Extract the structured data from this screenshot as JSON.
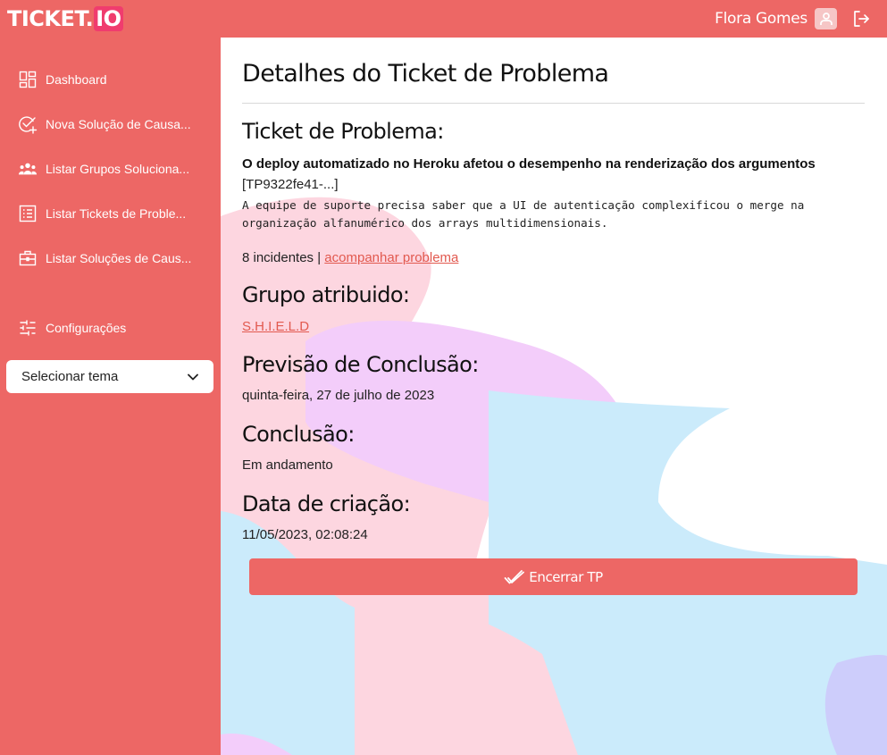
{
  "app": {
    "logo_main": "TICKET.",
    "logo_accent": "IO",
    "user_name": "Flora Gomes"
  },
  "sidebar": {
    "items": [
      {
        "label": "Dashboard",
        "icon": "dashboard-icon"
      },
      {
        "label": "Nova Solução de Causa...",
        "icon": "check-add-icon"
      },
      {
        "label": "Listar Grupos Soluciona...",
        "icon": "users-group-icon"
      },
      {
        "label": "Listar Tickets de Proble...",
        "icon": "list-icon"
      },
      {
        "label": "Listar Soluções de Caus...",
        "icon": "briefcase-icon"
      }
    ],
    "settings_label": "Configurações",
    "theme_select": "Selecionar tema"
  },
  "main": {
    "page_title": "Detalhes do Ticket de Problema",
    "ticket_heading": "Ticket de Problema:",
    "ticket_title": "O deploy automatizado no Heroku afetou o desempenho na renderização dos argumentos",
    "ticket_id": "[TP9322fe41-...]",
    "ticket_description": "A equipe de suporte precisa saber que a UI de autenticação complexificou o merge na organização alfanumérico dos arrays multidimensionais.",
    "incidents_text": "8 incidentes |",
    "follow_link": "acompanhar problema",
    "group_heading": "Grupo atribuido:",
    "group_link": "S.H.I.E.L.D",
    "forecast_heading": "Previsão de Conclusão:",
    "forecast_value": "quinta-feira, 27 de julho de 2023",
    "conclusion_heading": "Conclusão:",
    "conclusion_value": "Em andamento",
    "created_heading": "Data de criação:",
    "created_value": "11/05/2023, 02:08:24",
    "close_button": "Encerrar TP"
  },
  "colors": {
    "primary": "#ed6765",
    "logo_accent_bg": "#f03c6e",
    "link": "#e2594f",
    "bg_pink": "#fdd6e0",
    "bg_blue": "#cbebfb",
    "bg_purple": "#f3cdfa",
    "bg_lavender": "#cdcdfb"
  }
}
